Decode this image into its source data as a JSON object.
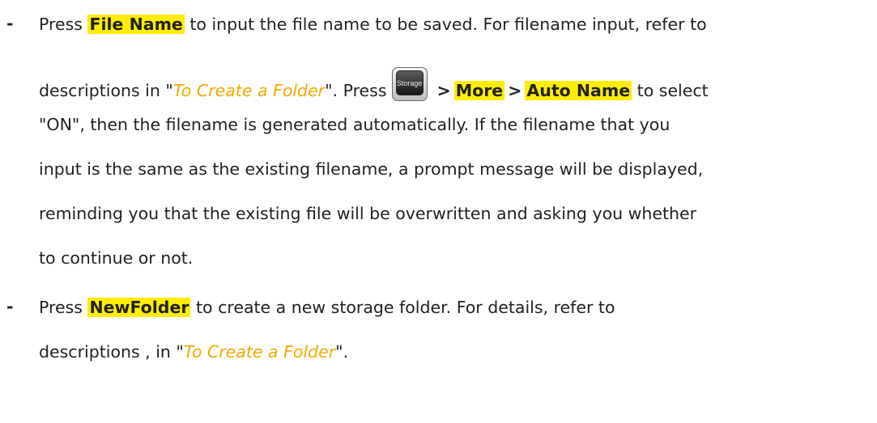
{
  "bullets": {
    "marker": "-"
  },
  "item1": {
    "l1_pre": "Press ",
    "file_name": "File Name",
    "l1_post": " to input the file name to be saved. For filename input, refer to",
    "l2_pre": "descriptions in \"",
    "link": "To Create a Folder",
    "l2_mid": "\". Press",
    "storage_key_label": "Storage",
    "gt1": ">",
    "more": "More",
    "gt2": ">",
    "auto_name": "Auto Name",
    "l2_post": " to select",
    "l3": "\"ON\", then the filename is generated automatically. If the filename that you",
    "l4": "input is the same as the existing filename, a prompt message will be displayed,",
    "l5": "reminding you that the existing file will be overwritten and asking you whether",
    "l6": "to continue or not."
  },
  "item2": {
    "l1_pre": "Press ",
    "new_folder": "NewFolder",
    "l1_post": " to create a new storage folder. For details, refer to",
    "l2_pre": "descriptions , in \"",
    "link": "To Create a Folder",
    "l2_post": "\"."
  }
}
